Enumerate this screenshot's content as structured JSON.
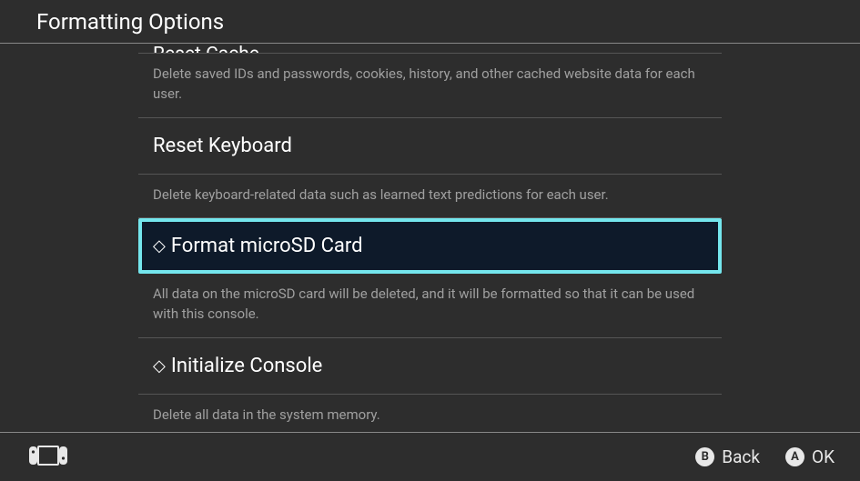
{
  "header": {
    "title": "Formatting Options"
  },
  "items": {
    "resetCache": {
      "title": "Reset Cache",
      "desc": "Delete saved IDs and passwords, cookies, history, and other cached website data for each user."
    },
    "resetKeyboard": {
      "title": "Reset Keyboard",
      "desc": "Delete keyboard-related data such as learned text predictions for each user."
    },
    "formatSd": {
      "title": "Format microSD Card",
      "desc": "All data on the microSD card will be deleted, and it will be formatted so that it can be used with this console."
    },
    "initConsole": {
      "title": "Initialize Console",
      "desc": "Delete all data in the system memory."
    }
  },
  "footer": {
    "back": "Back",
    "ok": "OK",
    "b": "B",
    "a": "A"
  }
}
